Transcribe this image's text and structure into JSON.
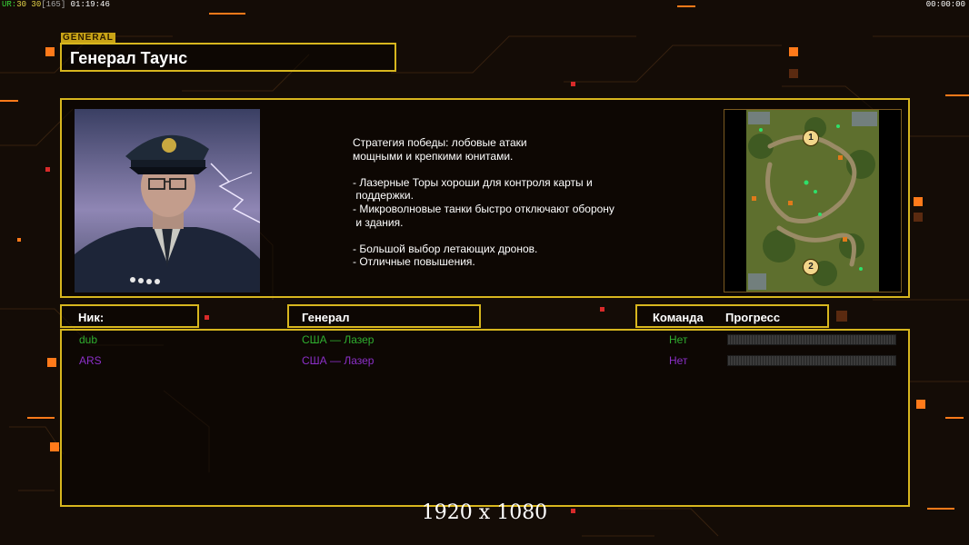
{
  "hud": {
    "ur_label": "UR:",
    "fps_current": "30",
    "fps_max": "30",
    "latency": "[165]",
    "clock": "01:19:46",
    "timer": "00:00:00"
  },
  "general": {
    "tag": "GENERAL",
    "name": "Генерал Таунс"
  },
  "description": {
    "lines": [
      "Стратегия победы: лобовые атаки",
      "мощными и крепкими юнитами.",
      "",
      "- Лазерные Торы хороши для контроля карты и",
      " поддержки.",
      "- Микроволновые танки быстро отключают оборону",
      " и здания.",
      "",
      "- Большой выбор летающих дронов.",
      "- Отличные повышения."
    ]
  },
  "map": {
    "start_positions": [
      "1",
      "2"
    ]
  },
  "table_headers": {
    "nick": "Ник:",
    "general": "Генерал",
    "team": "Команда",
    "progress": "Прогресс"
  },
  "players": [
    {
      "nick": "dub",
      "general": "США — Лазер",
      "team": "Нет",
      "color": "#2fae2f",
      "progress": 0
    },
    {
      "nick": "ARS",
      "general": "США — Лазер",
      "team": "Нет",
      "color": "#8c2fc8",
      "progress": 0
    }
  ],
  "resolution": "1920 x 1080",
  "colors": {
    "accent_yellow": "#d7b61e",
    "accent_orange": "#ff7a1a",
    "background": "#140c06"
  }
}
